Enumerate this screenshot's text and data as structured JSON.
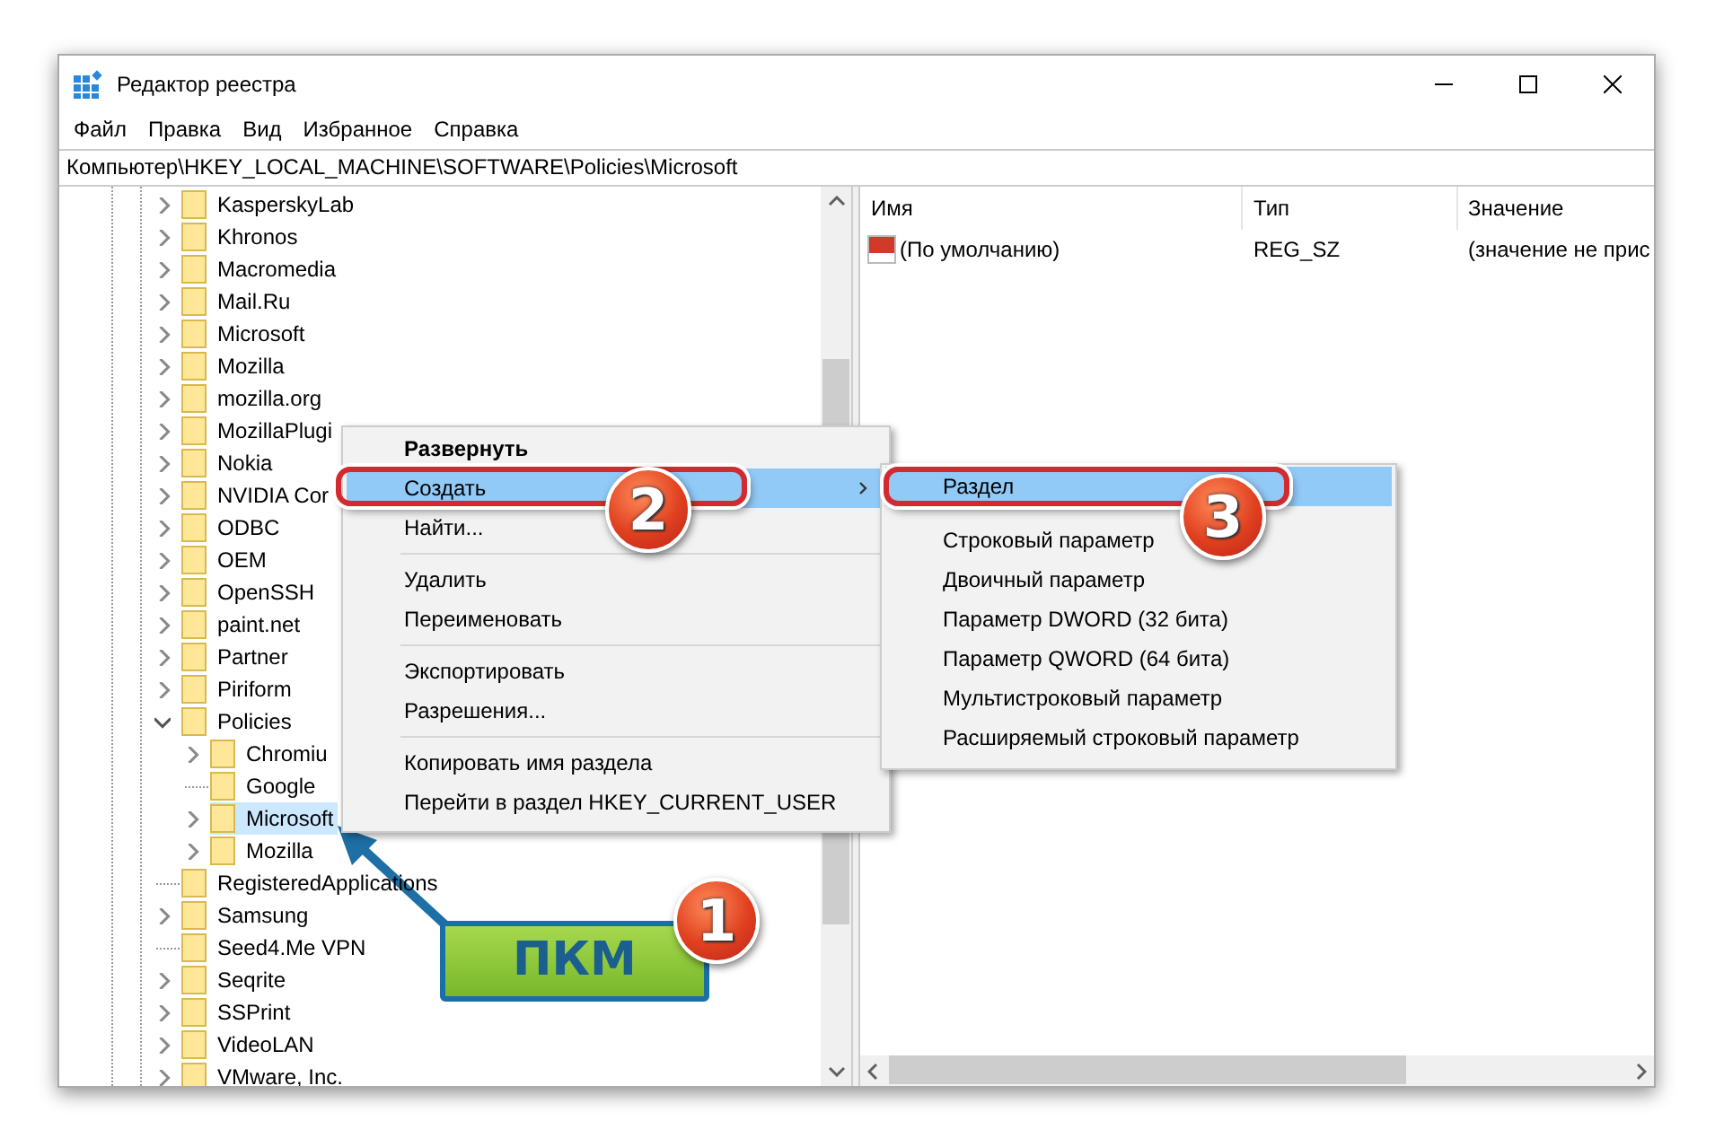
{
  "window": {
    "title": "Редактор реестра"
  },
  "menu_bar": [
    "Файл",
    "Правка",
    "Вид",
    "Избранное",
    "Справка"
  ],
  "address_bar": {
    "value": "Компьютер\\HKEY_LOCAL_MACHINE\\SOFTWARE\\Policies\\Microsoft"
  },
  "tree": [
    {
      "label": "KasperskyLab",
      "expandable": true,
      "expanded": false,
      "selected": false
    },
    {
      "label": "Khronos",
      "expandable": true,
      "expanded": false,
      "selected": false
    },
    {
      "label": "Macromedia",
      "expandable": true,
      "expanded": false,
      "selected": false
    },
    {
      "label": "Mail.Ru",
      "expandable": true,
      "expanded": false,
      "selected": false
    },
    {
      "label": "Microsoft",
      "expandable": true,
      "expanded": false,
      "selected": false
    },
    {
      "label": "Mozilla",
      "expandable": true,
      "expanded": false,
      "selected": false
    },
    {
      "label": "mozilla.org",
      "expandable": true,
      "expanded": false,
      "selected": false
    },
    {
      "label": "MozillaPlugi",
      "expandable": true,
      "expanded": false,
      "selected": false
    },
    {
      "label": "Nokia",
      "expandable": true,
      "expanded": false,
      "selected": false
    },
    {
      "label": "NVIDIA Cor",
      "expandable": true,
      "expanded": false,
      "selected": false
    },
    {
      "label": "ODBC",
      "expandable": true,
      "expanded": false,
      "selected": false
    },
    {
      "label": "OEM",
      "expandable": true,
      "expanded": false,
      "selected": false
    },
    {
      "label": "OpenSSH",
      "expandable": true,
      "expanded": false,
      "selected": false
    },
    {
      "label": "paint.net",
      "expandable": true,
      "expanded": false,
      "selected": false
    },
    {
      "label": "Partner",
      "expandable": true,
      "expanded": false,
      "selected": false
    },
    {
      "label": "Piriform",
      "expandable": true,
      "expanded": false,
      "selected": false
    },
    {
      "label": "Policies",
      "expandable": true,
      "expanded": true,
      "selected": false,
      "children": [
        {
          "label": "Chromiu",
          "expandable": true,
          "expanded": false,
          "selected": false
        },
        {
          "label": "Google",
          "expandable": false,
          "expanded": false,
          "selected": false
        },
        {
          "label": "Microsoft",
          "expandable": true,
          "expanded": false,
          "selected": true
        },
        {
          "label": "Mozilla",
          "expandable": true,
          "expanded": false,
          "selected": false
        }
      ]
    },
    {
      "label": "RegisteredApplications",
      "expandable": false,
      "expanded": false,
      "selected": false
    },
    {
      "label": "Samsung",
      "expandable": true,
      "expanded": false,
      "selected": false
    },
    {
      "label": "Seed4.Me VPN",
      "expandable": false,
      "expanded": false,
      "selected": false
    },
    {
      "label": "Seqrite",
      "expandable": true,
      "expanded": false,
      "selected": false
    },
    {
      "label": "SSPrint",
      "expandable": true,
      "expanded": false,
      "selected": false
    },
    {
      "label": "VideoLAN",
      "expandable": true,
      "expanded": false,
      "selected": false
    },
    {
      "label": "VMware, Inc.",
      "expandable": true,
      "expanded": false,
      "selected": false
    }
  ],
  "values_table": {
    "columns": [
      "Имя",
      "Тип",
      "Значение"
    ],
    "rows": [
      {
        "name": "(По умолчанию)",
        "type": "REG_SZ",
        "value": "(значение не прис"
      }
    ]
  },
  "context_menu": {
    "groups": [
      [
        {
          "label": "Развернуть",
          "default": true,
          "selected": false,
          "has_submenu": false
        },
        {
          "label": "Создать",
          "default": false,
          "selected": true,
          "has_submenu": true
        },
        {
          "label": "Найти...",
          "default": false,
          "selected": false,
          "has_submenu": false
        }
      ],
      [
        {
          "label": "Удалить",
          "default": false,
          "selected": false,
          "has_submenu": false
        },
        {
          "label": "Переименовать",
          "default": false,
          "selected": false,
          "has_submenu": false
        }
      ],
      [
        {
          "label": "Экспортировать",
          "default": false,
          "selected": false,
          "has_submenu": false
        },
        {
          "label": "Разрешения...",
          "default": false,
          "selected": false,
          "has_submenu": false
        }
      ],
      [
        {
          "label": "Копировать имя раздела",
          "default": false,
          "selected": false,
          "has_submenu": false
        },
        {
          "label": "Перейти в раздел HKEY_CURRENT_USER",
          "default": false,
          "selected": false,
          "has_submenu": false
        }
      ]
    ]
  },
  "submenu": {
    "groups": [
      [
        {
          "label": "Раздел",
          "selected": true
        }
      ],
      [
        {
          "label": "Строковый параметр",
          "selected": false
        },
        {
          "label": "Двоичный параметр",
          "selected": false
        },
        {
          "label": "Параметр DWORD (32 бита)",
          "selected": false
        },
        {
          "label": "Параметр QWORD (64 бита)",
          "selected": false
        },
        {
          "label": "Мультистроковый параметр",
          "selected": false
        },
        {
          "label": "Расширяемый строковый параметр",
          "selected": false
        }
      ]
    ]
  },
  "annotations": {
    "steps": [
      "1",
      "2",
      "3"
    ],
    "label": "ПКМ"
  }
}
